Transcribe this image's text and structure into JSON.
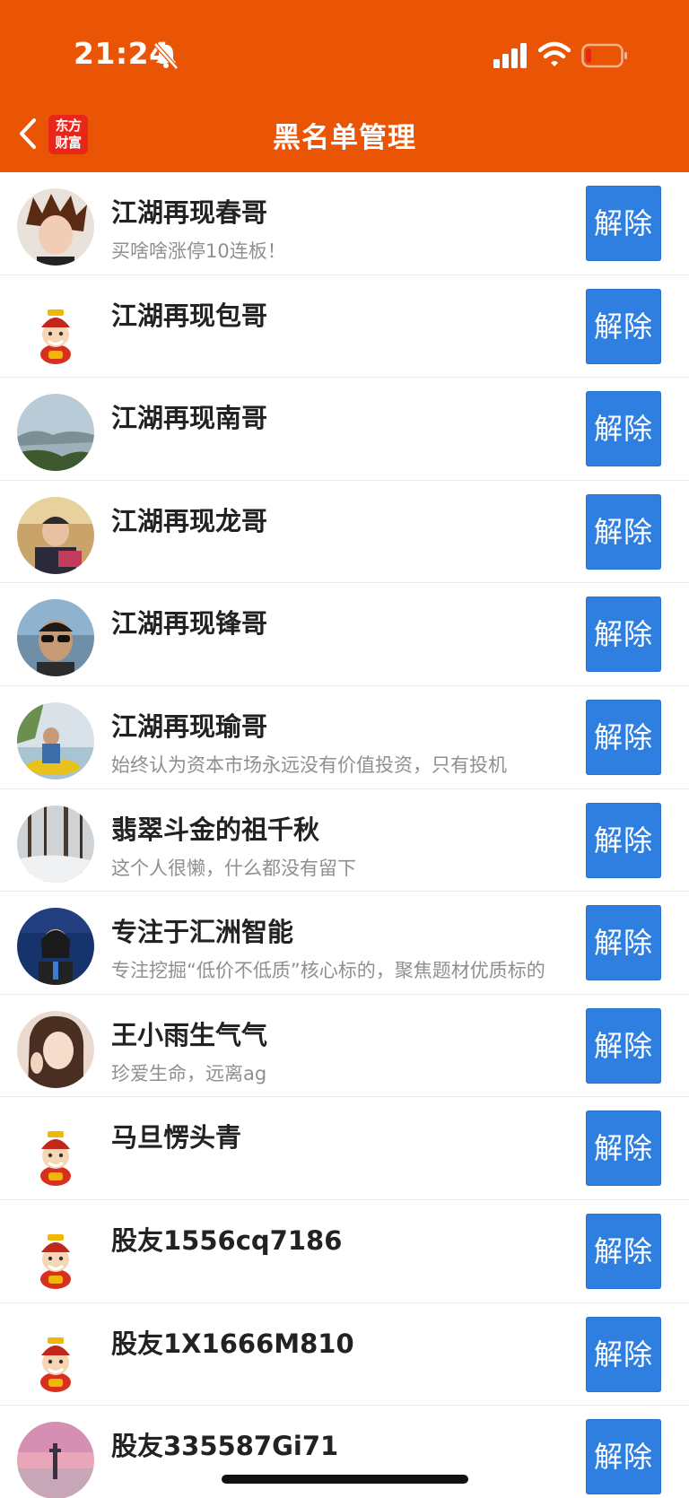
{
  "status_bar": {
    "time": "21:24"
  },
  "header": {
    "title": "黑名单管理",
    "logo_line1": "东方",
    "logo_line2": "财富"
  },
  "colors": {
    "header_bg": "#ea5505",
    "button_bg": "#2f7fe0",
    "logo_bg": "#e8261a"
  },
  "list": {
    "button_label": "解除",
    "items": [
      {
        "name": "江湖再现春哥",
        "desc": "买啥啥涨停10连板！",
        "avatar": "photo-person-spiky-hair"
      },
      {
        "name": "江湖再现包哥",
        "desc": "",
        "avatar": "default-mascot"
      },
      {
        "name": "江湖再现南哥",
        "desc": "",
        "avatar": "photo-landscape-lake"
      },
      {
        "name": "江湖再现龙哥",
        "desc": "",
        "avatar": "photo-person-speaker"
      },
      {
        "name": "江湖再现锋哥",
        "desc": "",
        "avatar": "photo-person-sunglasses"
      },
      {
        "name": "江湖再现瑜哥",
        "desc": "始终认为资本市场永远没有价值投资，只有投机",
        "avatar": "photo-person-boat"
      },
      {
        "name": "翡翠斗金的祖千秋",
        "desc": "这个人很懒，什么都没有留下",
        "avatar": "photo-snow-forest"
      },
      {
        "name": "专注于汇洲智能",
        "desc": "专注挖掘“低价不低质”核心标的，聚焦题材优质标的",
        "avatar": "photo-person-event"
      },
      {
        "name": "王小雨生气气",
        "desc": "珍爱生命，远离ag",
        "avatar": "photo-person-selfie"
      },
      {
        "name": "马旦愣头青",
        "desc": "",
        "avatar": "default-mascot"
      },
      {
        "name": "股友1556cq7186",
        "desc": "",
        "avatar": "default-mascot"
      },
      {
        "name": "股友1X1666M810",
        "desc": "",
        "avatar": "default-mascot"
      },
      {
        "name": "股友335587Gi71",
        "desc": "",
        "avatar": "photo-sunset-tower"
      }
    ]
  }
}
